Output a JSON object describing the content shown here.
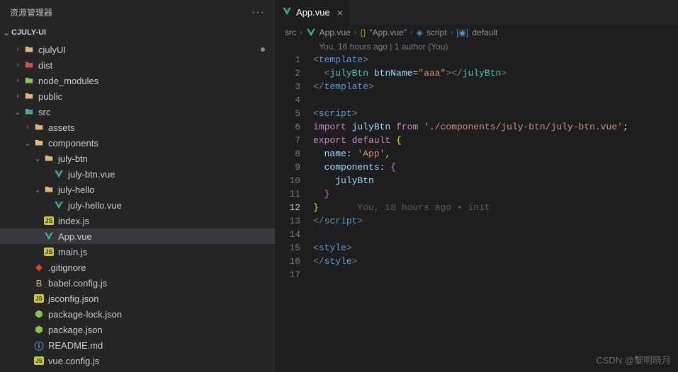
{
  "sidebar": {
    "title": "资源管理器",
    "project": "CJULY-UI",
    "tree": [
      {
        "indent": 18,
        "chev": "›",
        "icon": "folder",
        "cls": "folder-icon",
        "label": "cjulyUI",
        "dot": true
      },
      {
        "indent": 18,
        "chev": "›",
        "icon": "folder",
        "cls": "folder-red",
        "label": "dist"
      },
      {
        "indent": 18,
        "chev": "›",
        "icon": "folder",
        "cls": "folder-green",
        "label": "node_modules"
      },
      {
        "indent": 18,
        "chev": "›",
        "icon": "folder",
        "cls": "folder-icon",
        "label": "public"
      },
      {
        "indent": 18,
        "chev": "⌄",
        "icon": "folder",
        "cls": "folder-teal",
        "label": "src"
      },
      {
        "indent": 32,
        "chev": "›",
        "icon": "folder",
        "cls": "folder-icon",
        "label": "assets"
      },
      {
        "indent": 32,
        "chev": "⌄",
        "icon": "folder",
        "cls": "folder-icon",
        "label": "components"
      },
      {
        "indent": 46,
        "chev": "⌄",
        "icon": "folder",
        "cls": "folder-icon",
        "label": "july-btn"
      },
      {
        "indent": 60,
        "chev": "",
        "icon": "vue",
        "cls": "vue-icon",
        "label": "july-btn.vue"
      },
      {
        "indent": 46,
        "chev": "⌄",
        "icon": "folder",
        "cls": "folder-icon",
        "label": "july-hello"
      },
      {
        "indent": 60,
        "chev": "",
        "icon": "vue",
        "cls": "vue-icon",
        "label": "july-hello.vue"
      },
      {
        "indent": 46,
        "chev": "",
        "icon": "js",
        "cls": "",
        "label": "index.js"
      },
      {
        "indent": 46,
        "chev": "",
        "icon": "vue",
        "cls": "vue-icon",
        "label": "App.vue",
        "active": true
      },
      {
        "indent": 46,
        "chev": "",
        "icon": "js",
        "cls": "",
        "label": "main.js"
      },
      {
        "indent": 32,
        "chev": "",
        "icon": "git",
        "cls": "git-icon",
        "label": ".gitignore"
      },
      {
        "indent": 32,
        "chev": "",
        "icon": "babel",
        "cls": "json-icon",
        "label": "babel.config.js"
      },
      {
        "indent": 32,
        "chev": "",
        "icon": "json",
        "cls": "json-icon",
        "label": "jsconfig.json"
      },
      {
        "indent": 32,
        "chev": "",
        "icon": "pkg",
        "cls": "pkg-icon",
        "label": "package-lock.json"
      },
      {
        "indent": 32,
        "chev": "",
        "icon": "pkg",
        "cls": "pkg-icon",
        "label": "package.json"
      },
      {
        "indent": 32,
        "chev": "",
        "icon": "info",
        "cls": "info-icon",
        "label": "README.md"
      },
      {
        "indent": 32,
        "chev": "",
        "icon": "json",
        "cls": "json-icon",
        "label": "vue.config.js"
      }
    ]
  },
  "tab": {
    "label": "App.vue"
  },
  "breadcrumbs": {
    "items": [
      "src",
      "App.vue",
      "{} \"App.vue\"",
      "script",
      "default"
    ]
  },
  "codelens": "You, 16 hours ago | 1 author (You)",
  "inline_lens": "You, 18 hours ago • init",
  "code": {
    "l1": "template",
    "l2_el": "julyBtn",
    "l2_attr": "btnName",
    "l2_val": "\"aaa\"",
    "l5": "script",
    "l6_imp": "import",
    "l6_id": "julyBtn",
    "l6_from": "from",
    "l6_path": "'./components/july-btn/july-btn.vue'",
    "l7_exp": "export",
    "l7_def": "default",
    "l8_key": "name",
    "l8_val": "'App'",
    "l9_key": "components",
    "l10": "julyBtn",
    "l15": "style"
  },
  "watermark": "CSDN @黎明晓月"
}
